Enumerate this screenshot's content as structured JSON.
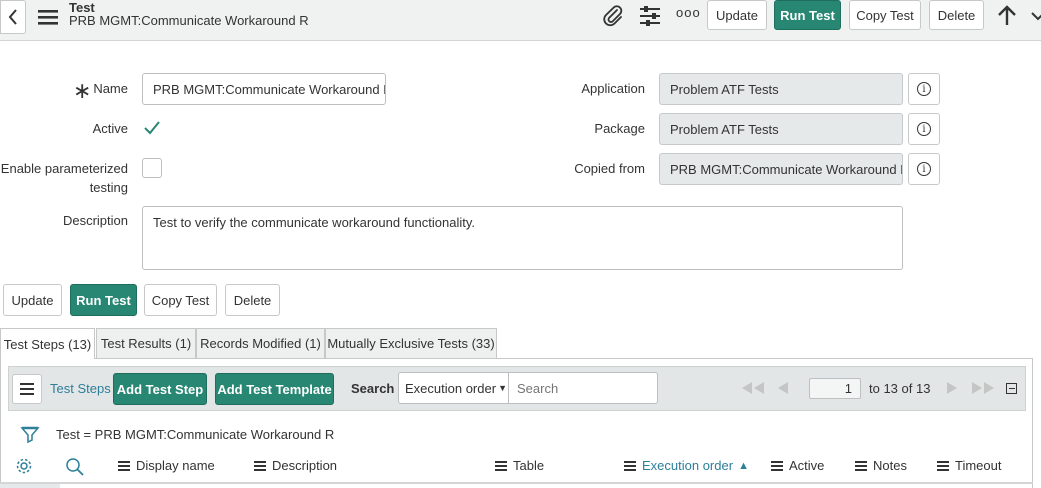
{
  "header": {
    "table_label": "Test",
    "record_title": "PRB MGMT:Communicate Workaround R",
    "buttons": {
      "update": "Update",
      "run_test": "Run Test",
      "copy_test": "Copy Test",
      "delete": "Delete"
    },
    "more_label": "ooo"
  },
  "form": {
    "name_label": "Name",
    "name_value": "PRB MGMT:Communicate Workaround R",
    "active_label": "Active",
    "active_checked": true,
    "param_label_1": "Enable parameterized",
    "param_label_2": "testing",
    "param_checked": false,
    "description_label": "Description",
    "description_value": "Test to verify the communicate workaround functionality.",
    "application_label": "Application",
    "application_value": "Problem ATF Tests",
    "package_label": "Package",
    "package_value": "Problem ATF Tests",
    "copied_from_label": "Copied from",
    "copied_from_value": "PRB MGMT:Communicate Workaround N",
    "required_mark": "∗"
  },
  "bottom_buttons": {
    "update": "Update",
    "run_test": "Run Test",
    "copy_test": "Copy Test",
    "delete": "Delete"
  },
  "tabs": [
    {
      "label": "Test Steps (13)",
      "active": true
    },
    {
      "label": "Test Results (1)",
      "active": false
    },
    {
      "label": "Records Modified (1)",
      "active": false
    },
    {
      "label": "Mutually Exclusive Tests (33)",
      "active": false
    }
  ],
  "list": {
    "title": "Test Steps",
    "add_step": "Add Test Step",
    "add_template": "Add Test Template",
    "search_label": "Search",
    "search_field": "Execution order",
    "search_placeholder": "Search",
    "page_current": "1",
    "page_total": "to 13 of 13",
    "filter_text": "Test = PRB MGMT:Communicate Workaround R",
    "columns": [
      "Display name",
      "Description",
      "Table",
      "Execution order",
      "Active",
      "Notes",
      "Timeout"
    ],
    "sort_indicator": "▲"
  },
  "colors": {
    "accent": "#278773",
    "link": "#2d7f9a",
    "header_bg": "#f0f2f2"
  }
}
